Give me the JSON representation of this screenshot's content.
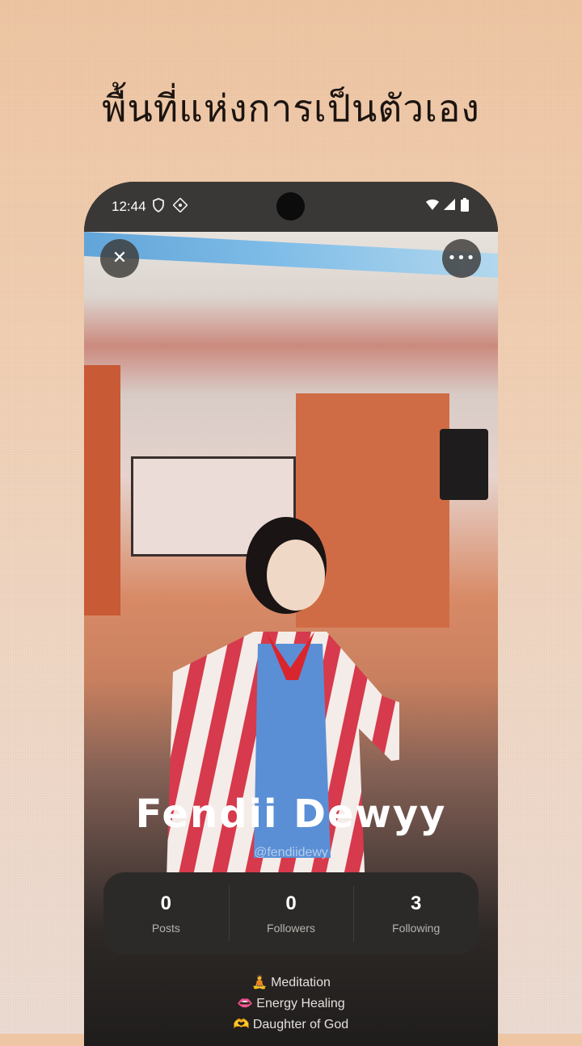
{
  "headline": "พื้นที่แห่งการเป็นตัวเอง",
  "status_bar": {
    "time": "12:44",
    "icons": [
      "shield-icon",
      "network-pattern-icon",
      "wifi-icon",
      "signal-icon",
      "battery-icon"
    ]
  },
  "profile": {
    "name": "Fendii Dewyy",
    "handle": "@fendiidewy",
    "stats": [
      {
        "value": "0",
        "label": "Posts"
      },
      {
        "value": "0",
        "label": "Followers"
      },
      {
        "value": "3",
        "label": "Following"
      }
    ],
    "bio": [
      {
        "emoji": "🧘",
        "text": "Meditation"
      },
      {
        "emoji": "👄",
        "text": "Energy Healing"
      },
      {
        "emoji": "🫶",
        "text": "Daughter of God"
      }
    ]
  },
  "buttons": {
    "close_icon": "close-icon",
    "more_icon": "more-horizontal-icon"
  },
  "colors": {
    "background": "#efcfb4",
    "phone_frame": "#1f1d1c",
    "stats_card": "#2c2a28",
    "text_primary": "#ffffff"
  }
}
